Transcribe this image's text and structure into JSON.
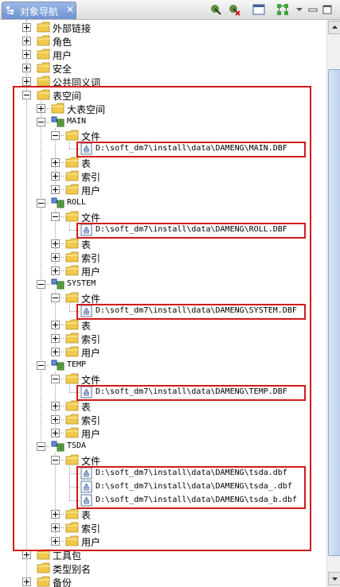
{
  "panel": {
    "title": "对象导航",
    "close_symbol": "✕",
    "toolbar_icons": [
      "connect-icon",
      "disconnect-icon",
      "window-icon",
      "tree-icon",
      "view-menu-icon",
      "minimize-icon",
      "maximize-icon"
    ]
  },
  "tree": [
    {
      "depth": 0,
      "type": "folder",
      "label": "外部链接",
      "expander": "plus"
    },
    {
      "depth": 0,
      "type": "folder",
      "label": "角色",
      "expander": "plus"
    },
    {
      "depth": 0,
      "type": "folder",
      "label": "用户",
      "expander": "plus"
    },
    {
      "depth": 0,
      "type": "folder",
      "label": "安全",
      "expander": "plus"
    },
    {
      "depth": 0,
      "type": "folder",
      "label": "公共同义词",
      "expander": "plus"
    },
    {
      "depth": 0,
      "type": "folder",
      "label": "表空间",
      "expander": "minus"
    },
    {
      "depth": 1,
      "type": "folder",
      "label": "大表空间",
      "expander": "plus"
    },
    {
      "depth": 1,
      "type": "tablespace",
      "label": "MAIN",
      "expander": "minus"
    },
    {
      "depth": 2,
      "type": "folder",
      "label": "文件",
      "expander": "minus"
    },
    {
      "depth": 3,
      "type": "file",
      "label": "D:\\soft_dm7\\install\\data\\DAMENG\\MAIN.DBF",
      "expander": "none"
    },
    {
      "depth": 2,
      "type": "folder",
      "label": "表",
      "expander": "plus"
    },
    {
      "depth": 2,
      "type": "folder",
      "label": "索引",
      "expander": "plus"
    },
    {
      "depth": 2,
      "type": "folder",
      "label": "用户",
      "expander": "plus"
    },
    {
      "depth": 1,
      "type": "tablespace",
      "label": "ROLL",
      "expander": "minus"
    },
    {
      "depth": 2,
      "type": "folder",
      "label": "文件",
      "expander": "minus"
    },
    {
      "depth": 3,
      "type": "file",
      "label": "D:\\soft_dm7\\install\\data\\DAMENG\\ROLL.DBF",
      "expander": "none"
    },
    {
      "depth": 2,
      "type": "folder",
      "label": "表",
      "expander": "plus"
    },
    {
      "depth": 2,
      "type": "folder",
      "label": "索引",
      "expander": "plus"
    },
    {
      "depth": 2,
      "type": "folder",
      "label": "用户",
      "expander": "plus"
    },
    {
      "depth": 1,
      "type": "tablespace",
      "label": "SYSTEM",
      "expander": "minus"
    },
    {
      "depth": 2,
      "type": "folder",
      "label": "文件",
      "expander": "minus"
    },
    {
      "depth": 3,
      "type": "file",
      "label": "D:\\soft_dm7\\install\\data\\DAMENG\\SYSTEM.DBF",
      "expander": "none"
    },
    {
      "depth": 2,
      "type": "folder",
      "label": "表",
      "expander": "plus"
    },
    {
      "depth": 2,
      "type": "folder",
      "label": "索引",
      "expander": "plus"
    },
    {
      "depth": 2,
      "type": "folder",
      "label": "用户",
      "expander": "plus"
    },
    {
      "depth": 1,
      "type": "tablespace",
      "label": "TEMP",
      "expander": "minus"
    },
    {
      "depth": 2,
      "type": "folder",
      "label": "文件",
      "expander": "minus"
    },
    {
      "depth": 3,
      "type": "file",
      "label": "D:\\soft_dm7\\install\\data\\DAMENG\\TEMP.DBF",
      "expander": "none"
    },
    {
      "depth": 2,
      "type": "folder",
      "label": "表",
      "expander": "plus"
    },
    {
      "depth": 2,
      "type": "folder",
      "label": "索引",
      "expander": "plus"
    },
    {
      "depth": 2,
      "type": "folder",
      "label": "用户",
      "expander": "plus"
    },
    {
      "depth": 1,
      "type": "tablespace",
      "label": "TSDA",
      "expander": "minus"
    },
    {
      "depth": 2,
      "type": "folder",
      "label": "文件",
      "expander": "minus"
    },
    {
      "depth": 3,
      "type": "file",
      "label": "D:\\soft_dm7\\install\\data\\DAMENG\\tsda.dbf",
      "expander": "none"
    },
    {
      "depth": 3,
      "type": "file",
      "label": "D:\\soft_dm7\\install\\data\\DAMENG\\tsda_.dbf",
      "expander": "none"
    },
    {
      "depth": 3,
      "type": "file",
      "label": "D:\\soft_dm7\\install\\data\\DAMENG\\tsda_b.dbf",
      "expander": "none"
    },
    {
      "depth": 2,
      "type": "folder",
      "label": "表",
      "expander": "plus"
    },
    {
      "depth": 2,
      "type": "folder",
      "label": "索引",
      "expander": "plus"
    },
    {
      "depth": 2,
      "type": "folder",
      "label": "用户",
      "expander": "plus"
    },
    {
      "depth": 0,
      "type": "folder",
      "label": "工具包",
      "expander": "plus"
    },
    {
      "depth": 0,
      "type": "folder",
      "label": "类型别名",
      "expander": "none"
    },
    {
      "depth": 0,
      "type": "folder",
      "label": "备份",
      "expander": "plus"
    }
  ],
  "highlights": [
    [
      9,
      9
    ],
    [
      15,
      15
    ],
    [
      21,
      21
    ],
    [
      27,
      27
    ],
    [
      33,
      35
    ],
    [
      5,
      38
    ]
  ],
  "colors": {
    "highlight": "#d21a1a",
    "folder": "#f2c94c",
    "tab": "#7a9cd6"
  }
}
